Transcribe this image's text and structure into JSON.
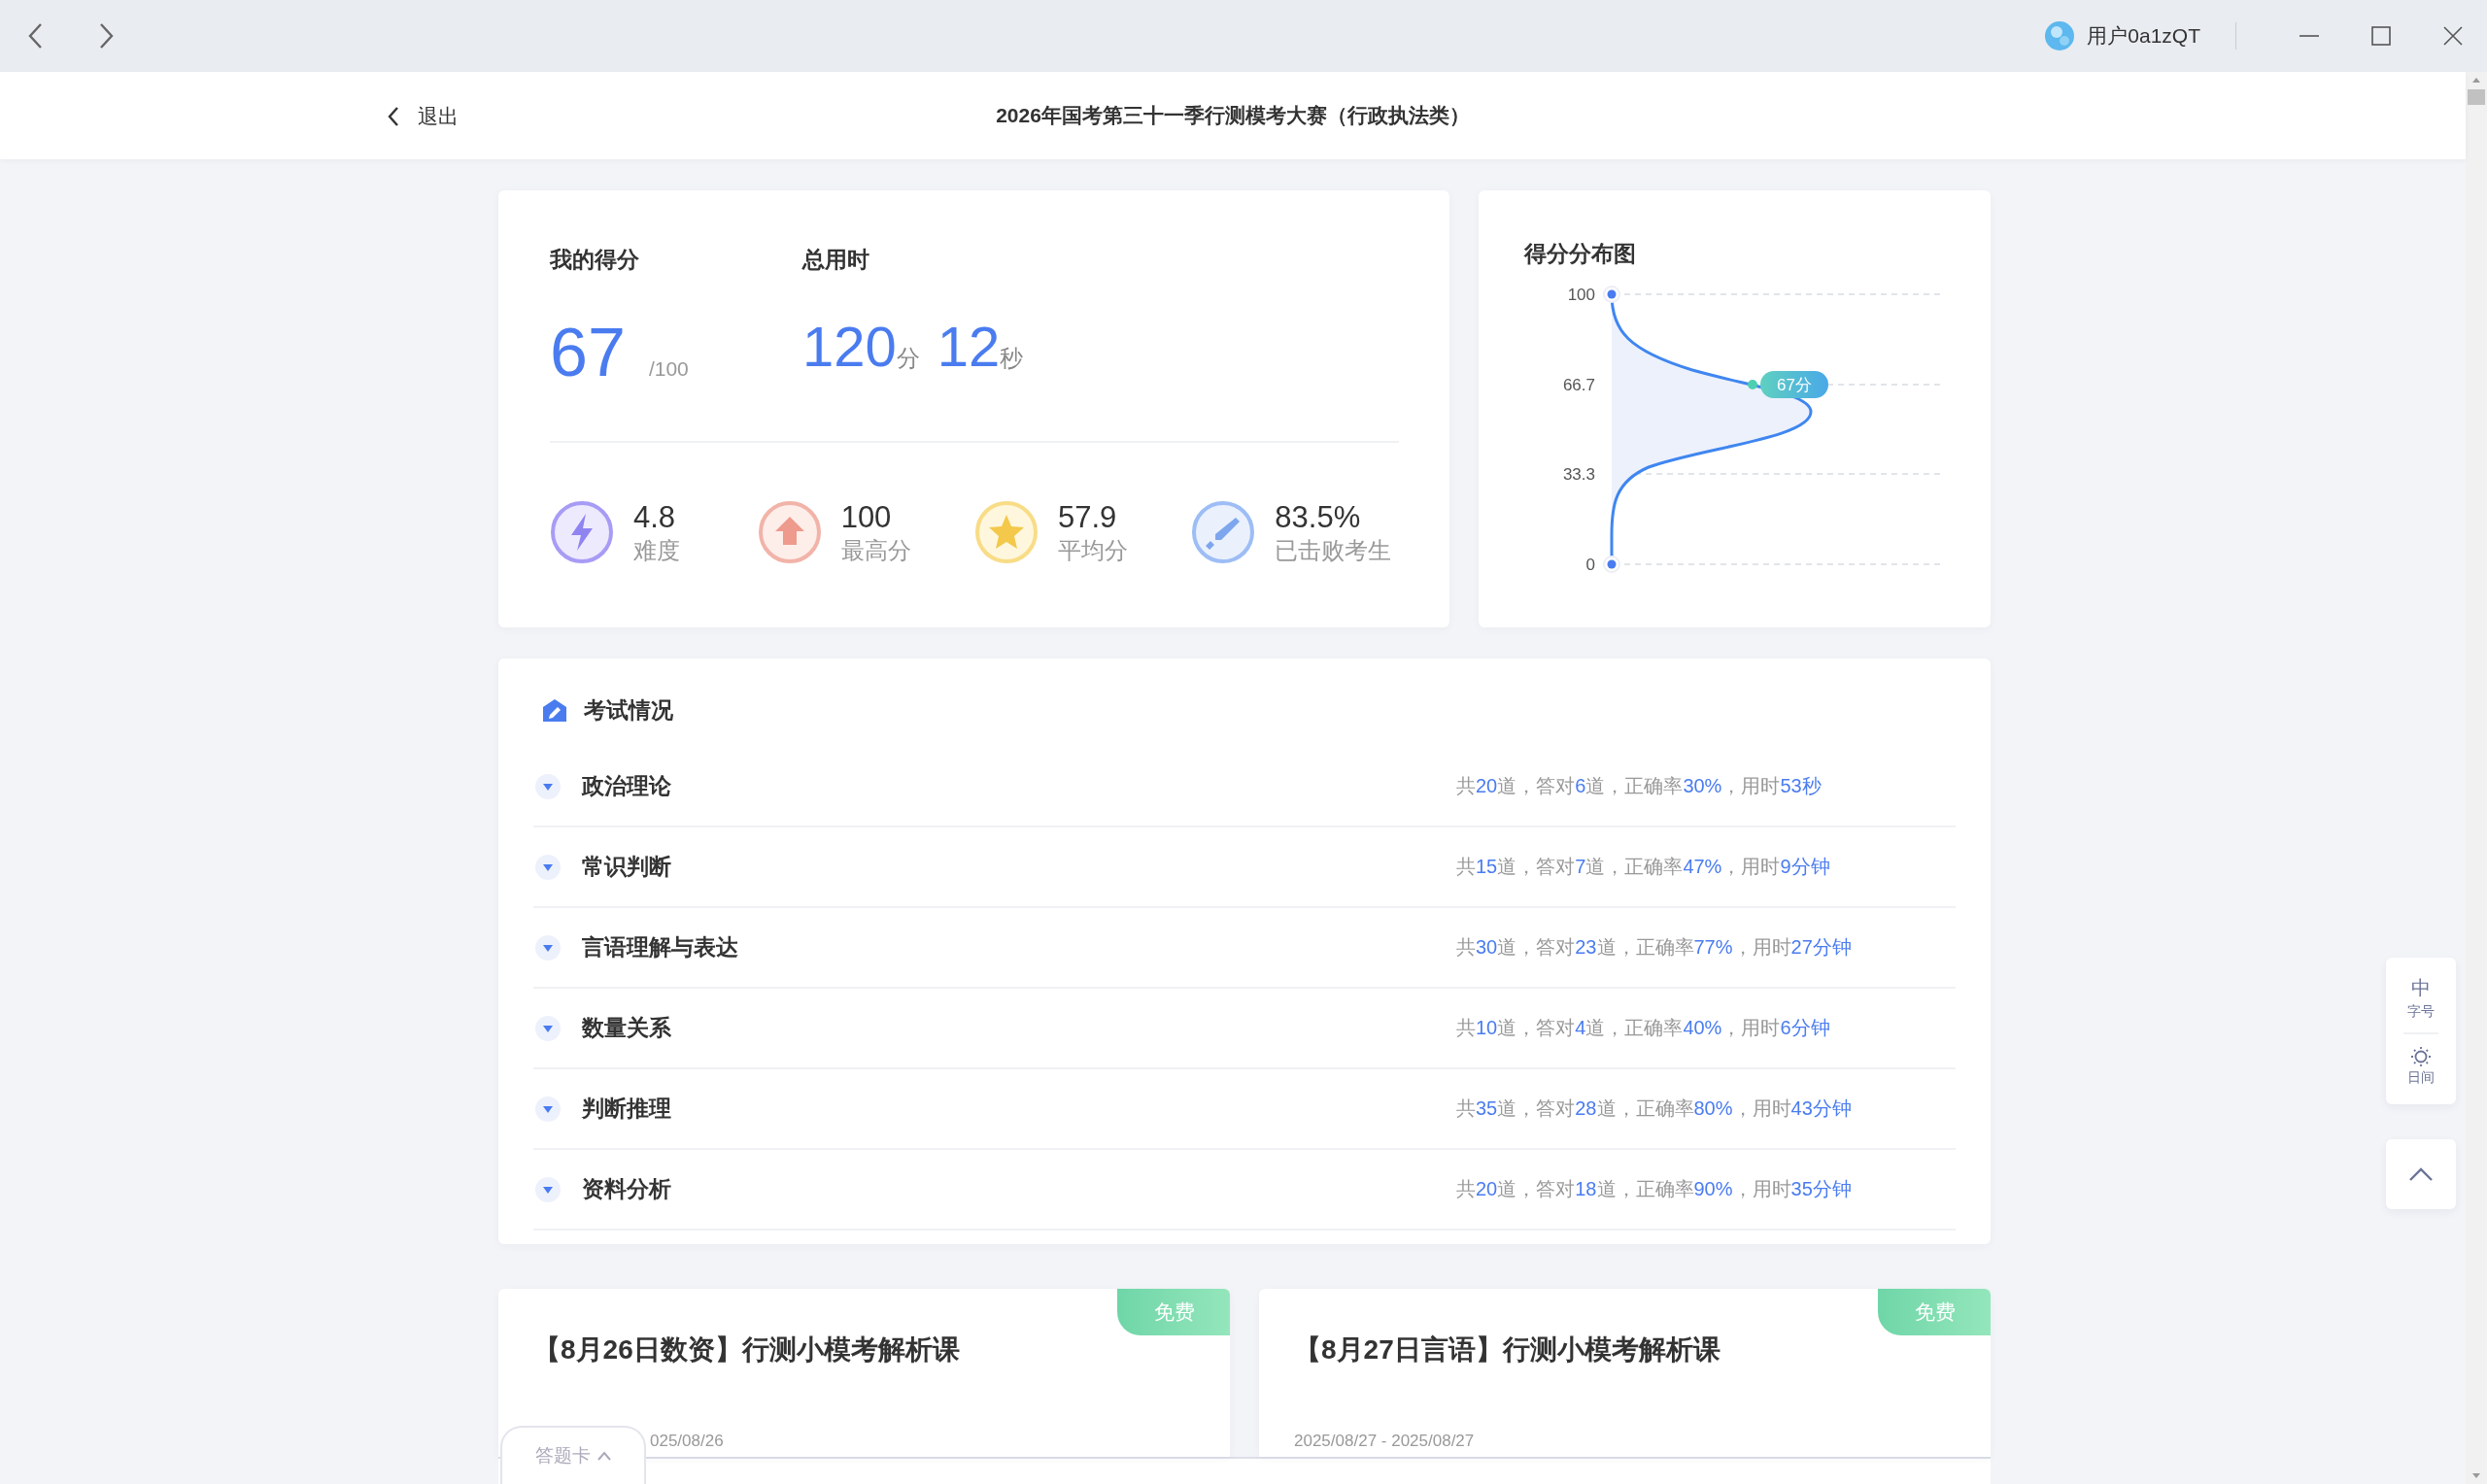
{
  "titlebar": {
    "user": "用户0a1zQT"
  },
  "nav": {
    "back_label": "退出",
    "title": "2026年国考第三十一季行测模考大赛（行政执法类）"
  },
  "score": {
    "label": "我的得分",
    "value": "67",
    "max": "/100"
  },
  "time": {
    "label": "总用时",
    "minutes": "120",
    "minutes_unit": "分",
    "seconds": "12",
    "seconds_unit": "秒"
  },
  "stats": [
    {
      "kind": "difficulty",
      "value": "4.8",
      "label": "难度"
    },
    {
      "kind": "highest",
      "value": "100",
      "label": "最高分"
    },
    {
      "kind": "average",
      "value": "57.9",
      "label": "平均分"
    },
    {
      "kind": "defeated",
      "value": "83.5%",
      "label": "已击败考生"
    }
  ],
  "distribution": {
    "title": "得分分布图",
    "ticks": [
      "100",
      "66.7",
      "33.3",
      "0"
    ],
    "marker": "67分"
  },
  "exam": {
    "title": "考试情况",
    "sections": [
      {
        "name": "政治理论",
        "summary": [
          {
            "t": "共",
            "hl": false
          },
          {
            "t": "20",
            "hl": true
          },
          {
            "t": "道，答对",
            "hl": false
          },
          {
            "t": "6",
            "hl": true
          },
          {
            "t": "道，正确率",
            "hl": false
          },
          {
            "t": "30%",
            "hl": true
          },
          {
            "t": "，用时",
            "hl": false
          },
          {
            "t": "53秒",
            "hl": true
          }
        ]
      },
      {
        "name": "常识判断",
        "summary": [
          {
            "t": "共",
            "hl": false
          },
          {
            "t": "15",
            "hl": true
          },
          {
            "t": "道，答对",
            "hl": false
          },
          {
            "t": "7",
            "hl": true
          },
          {
            "t": "道，正确率",
            "hl": false
          },
          {
            "t": "47%",
            "hl": true
          },
          {
            "t": "，用时",
            "hl": false
          },
          {
            "t": "9分钟",
            "hl": true
          }
        ]
      },
      {
        "name": "言语理解与表达",
        "summary": [
          {
            "t": "共",
            "hl": false
          },
          {
            "t": "30",
            "hl": true
          },
          {
            "t": "道，答对",
            "hl": false
          },
          {
            "t": "23",
            "hl": true
          },
          {
            "t": "道，正确率",
            "hl": false
          },
          {
            "t": "77%",
            "hl": true
          },
          {
            "t": "，用时",
            "hl": false
          },
          {
            "t": "27分钟",
            "hl": true
          }
        ]
      },
      {
        "name": "数量关系",
        "summary": [
          {
            "t": "共",
            "hl": false
          },
          {
            "t": "10",
            "hl": true
          },
          {
            "t": "道，答对",
            "hl": false
          },
          {
            "t": "4",
            "hl": true
          },
          {
            "t": "道，正确率",
            "hl": false
          },
          {
            "t": "40%",
            "hl": true
          },
          {
            "t": "，用时",
            "hl": false
          },
          {
            "t": "6分钟",
            "hl": true
          }
        ]
      },
      {
        "name": "判断推理",
        "summary": [
          {
            "t": "共",
            "hl": false
          },
          {
            "t": "35",
            "hl": true
          },
          {
            "t": "道，答对",
            "hl": false
          },
          {
            "t": "28",
            "hl": true
          },
          {
            "t": "道，正确率",
            "hl": false
          },
          {
            "t": "80%",
            "hl": true
          },
          {
            "t": "，用时",
            "hl": false
          },
          {
            "t": "43分钟",
            "hl": true
          }
        ]
      },
      {
        "name": "资料分析",
        "summary": [
          {
            "t": "共",
            "hl": false
          },
          {
            "t": "20",
            "hl": true
          },
          {
            "t": "道，答对",
            "hl": false
          },
          {
            "t": "18",
            "hl": true
          },
          {
            "t": "道，正确率",
            "hl": false
          },
          {
            "t": "90%",
            "hl": true
          },
          {
            "t": "，用时",
            "hl": false
          },
          {
            "t": "35分钟",
            "hl": true
          }
        ]
      }
    ]
  },
  "courses": [
    {
      "title": "【8月26日数资】行测小模考解析课",
      "badge": "免费",
      "dates": "025/08/26"
    },
    {
      "title": "【8月27日言语】行测小模考解析课",
      "badge": "免费",
      "dates": "2025/08/27 - 2025/08/27"
    }
  ],
  "answer_tab": {
    "label": "答题卡"
  },
  "side_tools": [
    {
      "kind": "font",
      "glyph": "中",
      "label": "字号"
    },
    {
      "kind": "theme",
      "label": "日间"
    }
  ]
}
